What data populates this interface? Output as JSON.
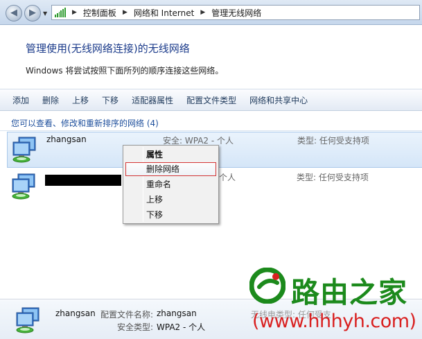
{
  "address_bar": {
    "breadcrumbs": [
      "控制面板",
      "网络和 Internet",
      "管理无线网络"
    ]
  },
  "header": {
    "title": "管理使用(无线网络连接)的无线网络",
    "description": "Windows 将尝试按照下面所列的顺序连接这些网络。"
  },
  "toolbar": {
    "add": "添加",
    "delete": "删除",
    "move_up": "上移",
    "move_down": "下移",
    "adapter_properties": "适配器属性",
    "profile_types": "配置文件类型",
    "network_center": "网络和共享中心"
  },
  "list": {
    "header": "您可以查看、修改和重新排序的网络 (4)",
    "rows": [
      {
        "name": "zhangsan",
        "security": "安全: WPA2 - 个人",
        "type": "类型: 任何受支持项"
      },
      {
        "name": "",
        "security": "个人",
        "type": "类型: 任何受支持项"
      }
    ]
  },
  "context_menu": {
    "items": [
      "属性",
      "删除网络",
      "重命名",
      "上移",
      "下移"
    ]
  },
  "details": {
    "name": "zhangsan",
    "profile_label": "配置文件名称:",
    "profile_value": "zhangsan",
    "security_label": "安全类型:",
    "security_value": "WPA2 - 个人",
    "right_text": "无线电类型: 任何受支"
  },
  "watermark": {
    "brand": "路由之家",
    "url": "(www.hhhyh.com)"
  },
  "colors": {
    "title_blue": "#1a3a8a",
    "link_blue": "#1e4f9c",
    "highlight_border": "#d33434",
    "watermark_green": "#1c8a1c",
    "watermark_red": "#d92020"
  }
}
